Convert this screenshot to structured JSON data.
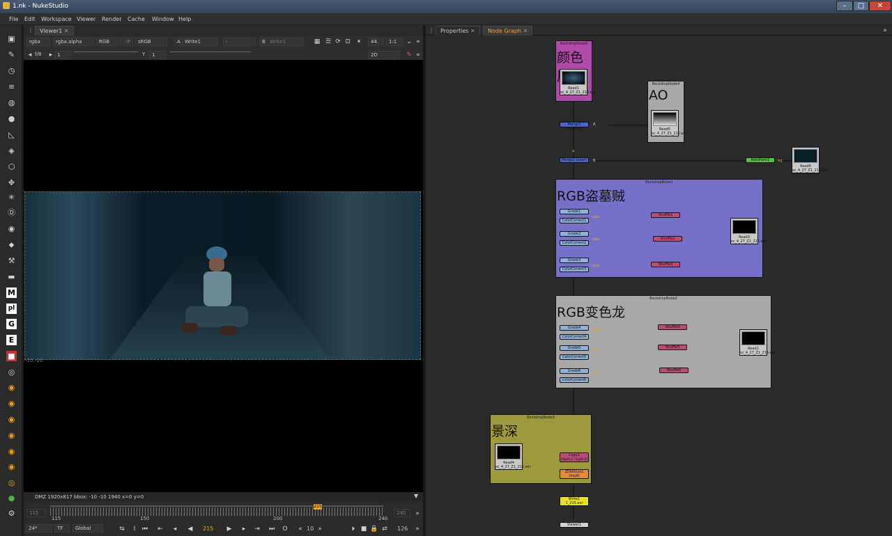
{
  "app": {
    "title": "1.nk - NukeStudio"
  },
  "menu": [
    "File",
    "Edit",
    "Workspace",
    "Viewer",
    "Render",
    "Cache",
    "Window",
    "Help"
  ],
  "viewer": {
    "tab": "Viewer1",
    "channels": "rgba",
    "alpha": "rgba.alpha",
    "rgb": "RGB",
    "ip": "IP",
    "colorspace": "sRGB",
    "a_label": "A",
    "a_input": "Write1",
    "b_dash": "-",
    "b_label": "B",
    "b_input": "Write1",
    "zoom": "44.",
    "ratio": "1:1",
    "fstop": "f/8",
    "gain_value": "1",
    "gamma_label": "Y",
    "gamma_value": "1",
    "mode": "2D",
    "corner_coords": "-10,-10",
    "status": "DMZ 1920x817   bbox: -10 -10 1940   x=0 y=0"
  },
  "timeline": {
    "start_field": "115",
    "end_field": "240",
    "current_marker": "215",
    "ticks": [
      "115",
      "150",
      "200",
      "240"
    ],
    "fps": "24*",
    "tf": "TF",
    "scope": "Global",
    "frame": "215",
    "step": "10",
    "end_frame": "126"
  },
  "ng": {
    "tabs": [
      "Properties",
      "Node Graph"
    ],
    "active_tab": "Node Graph"
  },
  "graph": {
    "backdrops": [
      {
        "title": "BackdropNode5",
        "label": "颜色层",
        "color": "#b04aa8"
      },
      {
        "title": "BackdropNode4",
        "label": "AO",
        "color": "#a8a8a8"
      },
      {
        "title": "BackdropNode1",
        "label": "RGB盗墓贼",
        "color": "#7770c8"
      },
      {
        "title": "BackdropNode2",
        "label": "RGB变色龙",
        "color": "#a8a8a8"
      },
      {
        "title": "BackdropNode3",
        "label": "景深",
        "color": "#9c9a3c"
      }
    ],
    "reads": [
      {
        "name": "Read1",
        "file": "sc_4_27_Z1_215.exr"
      },
      {
        "name": "Read5",
        "file": "sc_4_27_Z1_215.exr"
      },
      {
        "name": "Read6",
        "file": "sc_4_27_Z1_215.exr"
      },
      {
        "name": "Read3",
        "file": "sc_4_27_Z1_215.exr"
      },
      {
        "name": "Read2",
        "file": "sc_4_27_Z1_215.exr"
      },
      {
        "name": "Read4",
        "file": "sc_4_27_Z1_215.exr"
      }
    ],
    "merge1": "Merge1 (multiply)",
    "merge2": "Merge2 (over)",
    "roto": "RotoPaint1",
    "bg": "bg",
    "a1": "A",
    "a2": "A",
    "b2": "B",
    "grades": [
      "Grade1",
      "Grade2",
      "Grade3",
      "Grade4",
      "Grade5",
      "Grade6"
    ],
    "ccs": [
      "ColorCorrect1",
      "ColorCorrect2",
      "ColorCorrect3",
      "ColorCorrect4",
      "ColorCorrect5",
      "ColorCorrect6"
    ],
    "shuffles": [
      "Shuffle1",
      "Shuffle2",
      "Shuffle3",
      "Shuffle4",
      "Shuffle5",
      "Shuffle6"
    ],
    "mask": "rgba",
    "copy": "Copy1",
    "copy_sub": "(depth.Z / depth.Z)",
    "zdefocus": "ZDefocus1",
    "zdefocus_sub": "(mult)",
    "write": "Write1",
    "write_file": "1_215.exr",
    "viewer": "Viewer1"
  }
}
